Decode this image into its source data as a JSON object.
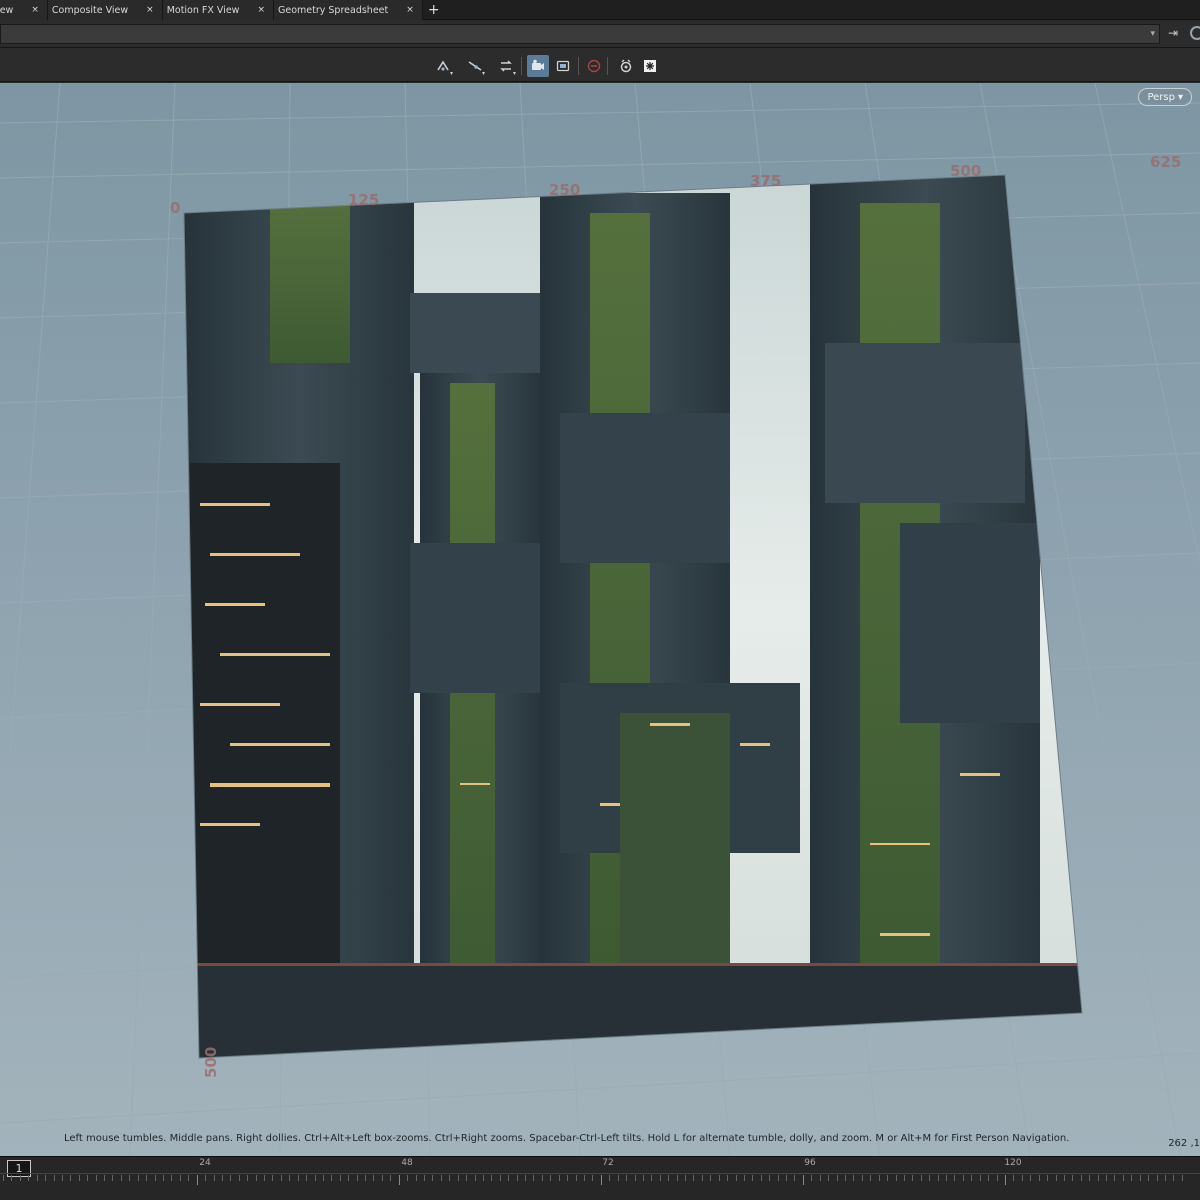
{
  "tabs": [
    {
      "label": "er View",
      "close": "×"
    },
    {
      "label": "Composite View",
      "close": "×"
    },
    {
      "label": "Motion FX View",
      "close": "×"
    },
    {
      "label": "Geometry Spreadsheet",
      "close": "×"
    }
  ],
  "tab_add": "+",
  "path": {
    "dropdown_arrow": "▾",
    "pin_icon": "pin-icon"
  },
  "toolbar": {
    "icons": [
      "snap-to-grid-icon",
      "snap-to-edge-icon",
      "swap-icon",
      "camera-settings-icon",
      "viewport-display-icon",
      "no-entry-icon",
      "render-camera-icon",
      "snowflake-icon"
    ],
    "active_icon": "camera-settings-icon"
  },
  "viewport": {
    "camera_menu": "Persp",
    "camera_arrow": "▾",
    "grid_ruler_labels": [
      "0",
      "125",
      "250",
      "375",
      "500",
      "625"
    ],
    "vertical_ruler_label": "500",
    "hint_text": "Left mouse tumbles. Middle pans. Right dollies. Ctrl+Alt+Left box-zooms. Ctrl+Right zooms. Spacebar-Ctrl-Left tilts. Hold L for alternate tumble, dolly, and zoom.      M or Alt+M for First Person Navigation.",
    "coords": "262 ,1",
    "image": {
      "description_name": "sci-fi-city-render",
      "sky_color": "#dde5e3",
      "tower_color": "#2f3d44",
      "glow_color": "#e8c27a",
      "moss_color": "#4f6b3a"
    }
  },
  "timeline": {
    "current_frame": "1",
    "labels": [
      "24",
      "48",
      "72",
      "96",
      "120"
    ]
  },
  "colors": {
    "active_tool": "#5b7c98",
    "viewport_top": "#7e96a3",
    "viewport_bottom": "#a3b3bc"
  }
}
